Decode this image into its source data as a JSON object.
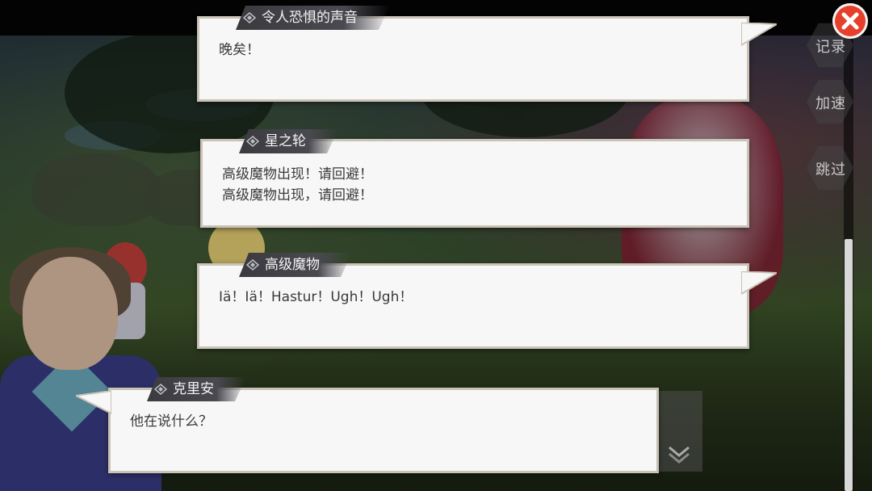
{
  "dialog": [
    {
      "speaker": "令人恐惧的声音",
      "lines": [
        "晚矣！"
      ]
    },
    {
      "speaker": "星之轮",
      "lines": [
        "高级魔物出现！请回避！",
        "高级魔物出现，请回避！"
      ]
    },
    {
      "speaker": "高级魔物",
      "lines": [
        "Iä！Iä！Hastur！Ugh！Ugh！"
      ]
    },
    {
      "speaker": "克里安",
      "lines": [
        "他在说什么？"
      ]
    }
  ],
  "side_buttons": {
    "log": "记录",
    "speed": "加速",
    "skip": "跳过"
  },
  "icons": {
    "close": "close-x-icon",
    "next": "chevron-down-icon",
    "nameplate_ornament": "diamond-ornament-icon"
  },
  "colors": {
    "close_button": "#e6402c",
    "bubble_bg": "#f7f7f7",
    "nameplate_bg": "#3b3a3f",
    "scroll_thumb": "#d8d8d8"
  }
}
